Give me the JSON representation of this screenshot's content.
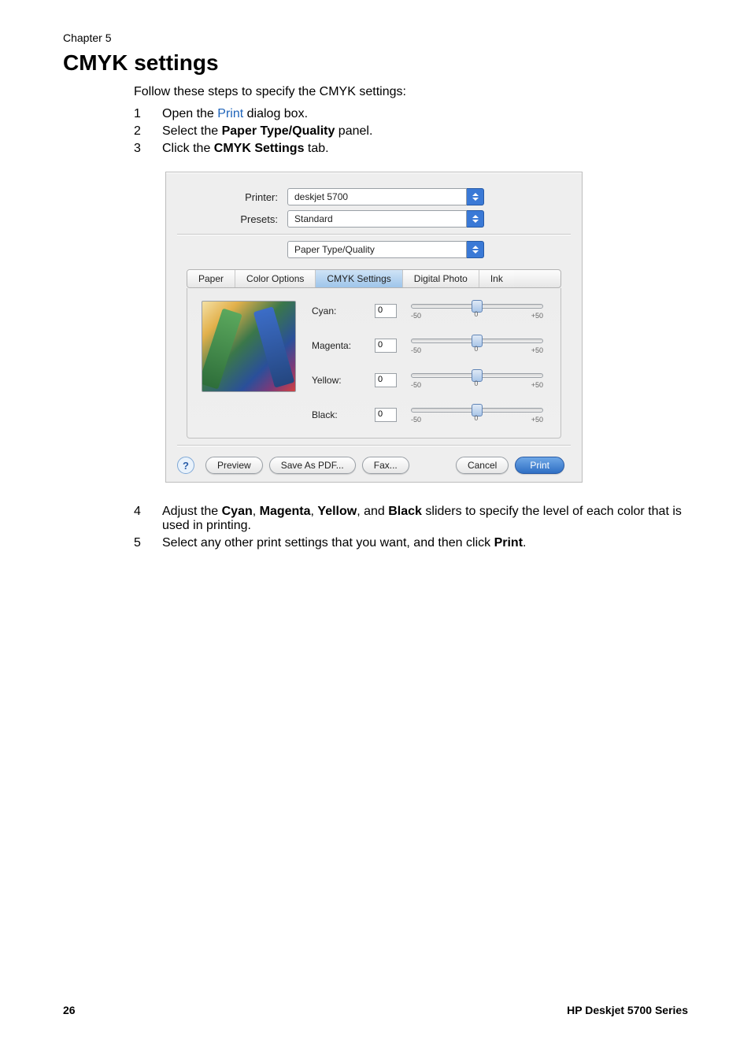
{
  "chapter": "Chapter 5",
  "heading": "CMYK settings",
  "intro": "Follow these steps to specify the CMYK settings:",
  "steps_top": [
    {
      "num": "1",
      "prefix": "Open the ",
      "link": "Print",
      "suffix": " dialog box."
    },
    {
      "num": "2",
      "prefix": "Select the ",
      "bold": "Paper Type/Quality",
      "suffix": " panel."
    },
    {
      "num": "3",
      "prefix": "Click the ",
      "bold": "CMYK Settings",
      "suffix": " tab."
    }
  ],
  "dialog": {
    "printer_label": "Printer:",
    "printer_value": "deskjet 5700",
    "presets_label": "Presets:",
    "presets_value": "Standard",
    "section_value": "Paper Type/Quality",
    "tabs": [
      "Paper",
      "Color Options",
      "CMYK Settings",
      "Digital Photo",
      "Ink"
    ],
    "active_tab_index": 2,
    "sliders": [
      {
        "label": "Cyan:",
        "value": "0",
        "min": "-50",
        "mid": "0",
        "max": "+50"
      },
      {
        "label": "Magenta:",
        "value": "0",
        "min": "-50",
        "mid": "0",
        "max": "+50"
      },
      {
        "label": "Yellow:",
        "value": "0",
        "min": "-50",
        "mid": "0",
        "max": "+50"
      },
      {
        "label": "Black:",
        "value": "0",
        "min": "-50",
        "mid": "0",
        "max": "+50"
      }
    ],
    "help": "?",
    "buttons": {
      "preview": "Preview",
      "save_pdf": "Save As PDF...",
      "fax": "Fax...",
      "cancel": "Cancel",
      "print": "Print"
    }
  },
  "steps_bottom": [
    {
      "num": "4",
      "text_a": "Adjust the ",
      "b1": "Cyan",
      "c1": ", ",
      "b2": "Magenta",
      "c2": ", ",
      "b3": "Yellow",
      "c3": ", and ",
      "b4": "Black",
      "text_b": " sliders to specify the level of each color that is used in printing."
    },
    {
      "num": "5",
      "text_a": "Select any other print settings that you want, and then click ",
      "b1": "Print",
      "text_b": "."
    }
  ],
  "footer": {
    "page": "26",
    "model": "HP Deskjet 5700 Series"
  }
}
